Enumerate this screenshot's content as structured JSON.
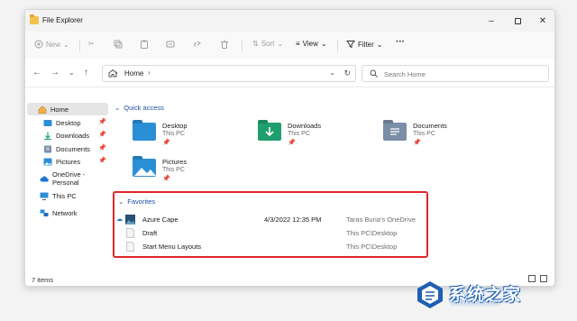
{
  "window": {
    "title": "File Explorer"
  },
  "toolbar": {
    "new_label": "New",
    "sort_label": "Sort",
    "view_label": "View",
    "filter_label": "Filter",
    "more_label": "···"
  },
  "address": {
    "path_label": "Home",
    "search_placeholder": "Search Home"
  },
  "sidebar": {
    "items": [
      {
        "label": "Home",
        "icon": "home-icon",
        "pinned": false
      },
      {
        "label": "Desktop",
        "icon": "desktop-folder-icon",
        "pinned": true
      },
      {
        "label": "Downloads",
        "icon": "download-icon",
        "pinned": true
      },
      {
        "label": "Documents",
        "icon": "documents-folder-icon",
        "pinned": true
      },
      {
        "label": "Pictures",
        "icon": "pictures-folder-icon",
        "pinned": true
      },
      {
        "label": "OneDrive - Personal",
        "icon": "cloud-icon",
        "pinned": false
      },
      {
        "label": "This PC",
        "icon": "pc-icon",
        "pinned": false
      },
      {
        "label": "Network",
        "icon": "network-icon",
        "pinned": false
      }
    ]
  },
  "quick_access": {
    "heading": "Quick access",
    "tiles": [
      {
        "name": "Desktop",
        "location": "This PC",
        "color": "#2b8fd6"
      },
      {
        "name": "Downloads",
        "location": "This PC",
        "color": "#1f9e6f"
      },
      {
        "name": "Documents",
        "location": "This PC",
        "color": "#7a8ea6"
      },
      {
        "name": "Pictures",
        "location": "This PC",
        "color": "#2b8fd6"
      }
    ]
  },
  "favorites": {
    "heading": "Favorites",
    "rows": [
      {
        "name": "Azure Cape",
        "date": "4/3/2022 12:35 PM",
        "location": "Taras Buria's OneDrive"
      },
      {
        "name": "Draft",
        "date": "",
        "location": "This PC\\Desktop"
      },
      {
        "name": "Start Menu Layouts",
        "date": "",
        "location": "This PC\\Desktop"
      }
    ]
  },
  "status": {
    "item_count": "7 items"
  },
  "watermark": {
    "text": "系统之家",
    "url": "XITONGZHIJIA.NET"
  },
  "colors": {
    "accent": "#1b4fa0",
    "highlight_box": "#e0262b"
  }
}
